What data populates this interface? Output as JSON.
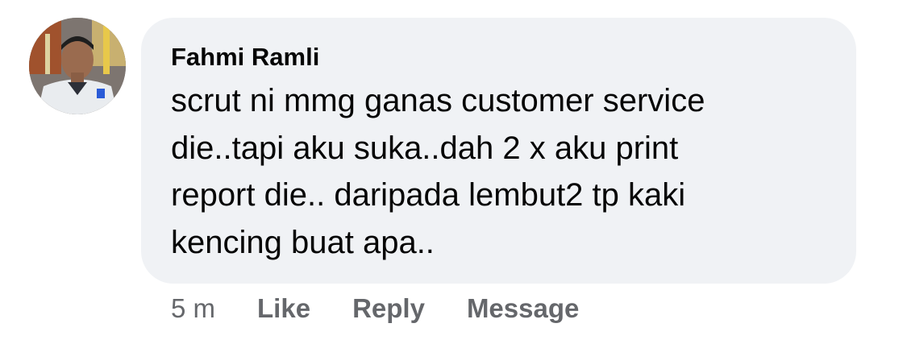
{
  "comment": {
    "author_name": "Fahmi Ramli",
    "text": "scrut ni mmg ganas customer service\ndie..tapi aku suka..dah 2 x aku print\nreport die.. daripada lembut2 tp kaki\nkencing buat apa..",
    "bubble_color": "#f0f2f5",
    "avatar_icon": "profile-photo"
  },
  "actions": {
    "timestamp": "5 m",
    "like_label": "Like",
    "reply_label": "Reply",
    "message_label": "Message",
    "color": "#65676b"
  }
}
